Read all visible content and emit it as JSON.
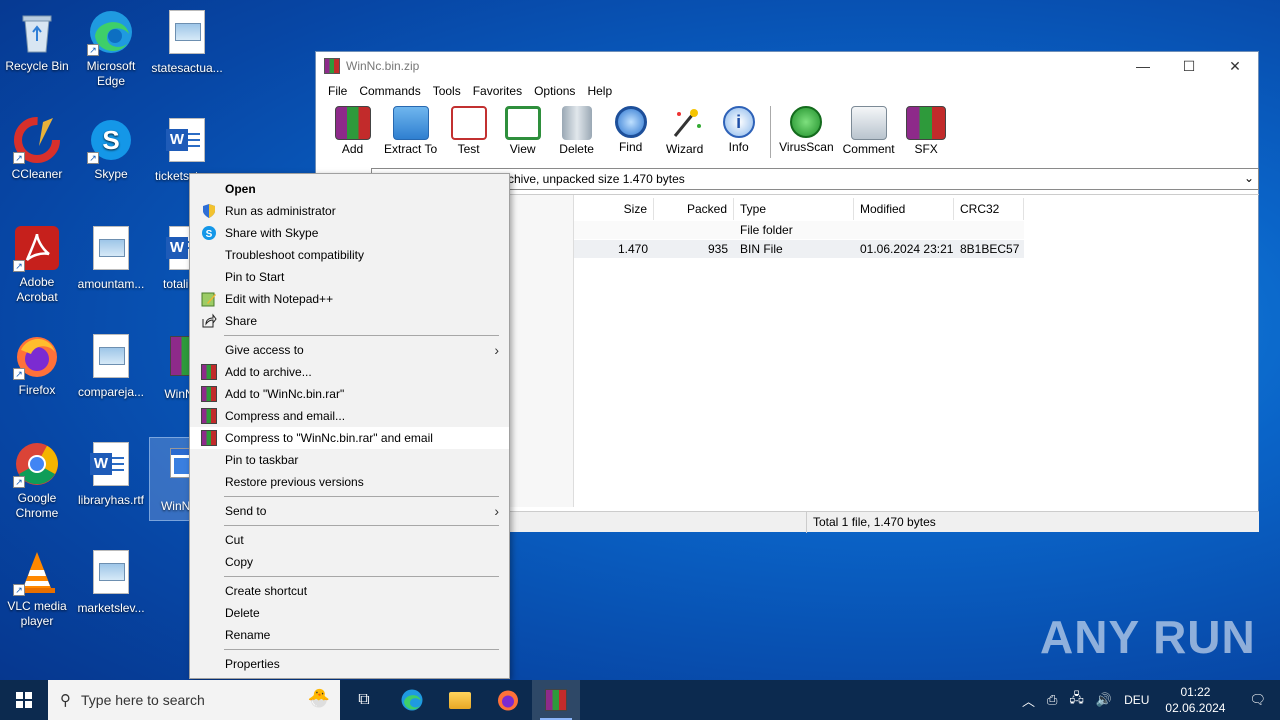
{
  "desktop": {
    "icons": [
      {
        "label": "Recycle Bin"
      },
      {
        "label": "Microsoft Edge"
      },
      {
        "label": "statesactua..."
      },
      {
        "label": "CCleaner"
      },
      {
        "label": "Skype"
      },
      {
        "label": "ticketsstro..."
      },
      {
        "label": "Adobe Acrobat"
      },
      {
        "label": "amountam..."
      },
      {
        "label": "totalinc..."
      },
      {
        "label": "Firefox"
      },
      {
        "label": "compareja..."
      },
      {
        "label": "WinNc..."
      },
      {
        "label": "Google Chrome"
      },
      {
        "label": "libraryhas.rtf"
      },
      {
        "label": "WinNc...e"
      },
      {
        "label": "VLC media player"
      },
      {
        "label": "marketslev..."
      }
    ]
  },
  "window": {
    "title": "WinNc.bin.zip",
    "controls": {
      "minimize": "—",
      "maximize": "☐",
      "close": "✕"
    },
    "menu": [
      "File",
      "Commands",
      "Tools",
      "Favorites",
      "Options",
      "Help"
    ],
    "toolbar": [
      "Add",
      "Extract To",
      "Test",
      "View",
      "Delete",
      "Find",
      "Wizard",
      "Info",
      "VirusScan",
      "Comment",
      "SFX"
    ],
    "address": "chive, unpacked size 1.470 bytes",
    "columns": [
      "Size",
      "Packed",
      "Type",
      "Modified",
      "CRC32"
    ],
    "rows": [
      {
        "size": "",
        "packed": "",
        "type": "File folder",
        "modified": "",
        "crc": ""
      },
      {
        "size": "1.470",
        "packed": "935",
        "type": "BIN File",
        "modified": "01.06.2024 23:21",
        "crc": "8B1BEC57"
      }
    ],
    "status": "Total 1 file, 1.470 bytes"
  },
  "context_menu": {
    "groups": [
      [
        "Open",
        "Run as administrator",
        "Share with Skype",
        "Troubleshoot compatibility",
        "Pin to Start",
        "Edit with Notepad++",
        "Share"
      ],
      [
        "Give access to",
        "Add to archive...",
        "Add to \"WinNc.bin.rar\"",
        "Compress and email...",
        "Compress to \"WinNc.bin.rar\" and email",
        "Pin to taskbar",
        "Restore previous versions"
      ],
      [
        "Send to"
      ],
      [
        "Cut",
        "Copy"
      ],
      [
        "Create shortcut",
        "Delete",
        "Rename"
      ],
      [
        "Properties"
      ]
    ]
  },
  "taskbar": {
    "search_placeholder": "Type here to search",
    "language": "DEU",
    "time": "01:22",
    "date": "02.06.2024"
  },
  "watermark": "ANY RUN"
}
